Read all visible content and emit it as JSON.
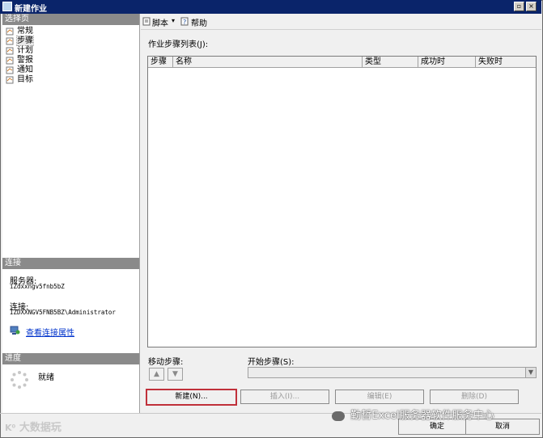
{
  "window": {
    "title": "新建作业"
  },
  "left": {
    "select_page_header": "选择页",
    "nav": [
      {
        "label": "常规",
        "icon": "page-icon"
      },
      {
        "label": "步骤",
        "icon": "page-icon",
        "selected": true
      },
      {
        "label": "计划",
        "icon": "page-icon"
      },
      {
        "label": "警报",
        "icon": "page-icon"
      },
      {
        "label": "通知",
        "icon": "page-icon"
      },
      {
        "label": "目标",
        "icon": "page-icon"
      }
    ],
    "connection_header": "连接",
    "server_label": "服务器:",
    "server_value": "iZdxxngv5fnb5bZ",
    "connection_label": "连接:",
    "connection_value": "IZDXXNGV5FNB5BZ\\Administrator",
    "view_link": "查看连接属性",
    "progress_header": "进度",
    "progress_status": "就绪"
  },
  "toolbar": {
    "script": "脚本",
    "help": "帮助"
  },
  "main": {
    "list_label": "作业步骤列表(J):",
    "columns": [
      "步骤",
      "名称",
      "类型",
      "成功时",
      "失败时"
    ],
    "move_label": "移动步骤:",
    "start_label": "开始步骤(S):",
    "start_value": "",
    "new_btn": "新建(N)...",
    "insert_btn": "插入(I)...",
    "edit_btn": "编辑(E)",
    "delete_btn": "删除(D)"
  },
  "footer": {
    "ok": "确定",
    "cancel": "取消",
    "watermark_left": "大数据玩",
    "watermark_right": "勤哲Excel服务器软件服务中心"
  },
  "colors": {
    "title_bar": "#0a246a",
    "section_header": "#8a8a8a",
    "focus_border": "#c0303a",
    "link": "#0033cc"
  }
}
